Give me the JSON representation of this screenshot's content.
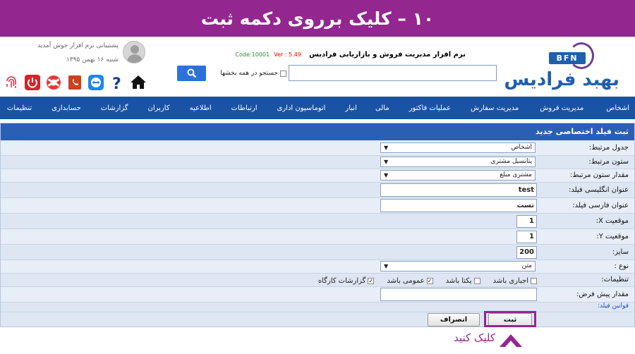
{
  "banner": {
    "text": "۱۰ – کلیک برروی دکمه ثبت"
  },
  "header": {
    "logo_badge": "BFN",
    "logo_text": "بهبد فرادیس",
    "app_name": "نرم افزار مدیریت فروش و بازاریابی فرادیس",
    "code": "Code:10001",
    "version": "Ver : 5.49",
    "search_placeholder": "",
    "search_all_label": "جستجو در همه بخشها",
    "user_support": "پشتیبانی نرم افزار خوش آمدید",
    "user_date": "شنبه ۱۶ بهمن ۱۳۹۵"
  },
  "icons": [
    "fingerprint-icon",
    "power-icon",
    "lifebuoy-icon",
    "phonebook-icon",
    "teamviewer-icon",
    "help-icon",
    "home-icon"
  ],
  "nav": {
    "items": [
      "اشخاص",
      "مدیریت فروش",
      "مدیریت سفارش",
      "عملیات فاکتور",
      "مالی",
      "انبار",
      "اتوماسیون اداری",
      "ارتباطات",
      "اطلاعیه",
      "کاربران",
      "گزارشات",
      "حسابداری",
      "تنظیمات"
    ]
  },
  "form": {
    "title": "ثبت فیلد اختصاصی جدید",
    "fields": {
      "table_label": "جدول مرتبط:",
      "table_value": "اشخاص",
      "column_label": "ستون مرتبط:",
      "column_value": "پتانسیل مشتری",
      "column_value_label": "مقدار ستون مرتبط:",
      "column_value_value": "مشتری مبلغ",
      "english_title_label": "عنوان انگلیسی فیلد:",
      "english_title_value": "test",
      "persian_title_label": "عنوان فارسی فیلد:",
      "persian_title_value": "تست",
      "pos_x_label": "موقعیت X:",
      "pos_x_value": "1",
      "pos_y_label": "موقعیت Y:",
      "pos_y_value": "1",
      "size_label": "سایز:",
      "size_value": "200",
      "type_label": "نوع :",
      "type_value": "متن",
      "settings_label": "تنظیمات:",
      "opt_required": "اجباری باشد",
      "opt_unique": "یکتا باشد",
      "opt_public": "عمومی باشد",
      "opt_reports": "گزارشات کارگاه",
      "default_label": "مقدار پیش فرض:",
      "default_value": "",
      "rules_link": "قوانین فیلد:"
    },
    "submit_label": "ثبت",
    "cancel_label": "انصراف"
  },
  "hint": {
    "text": "کلیک کنید"
  }
}
